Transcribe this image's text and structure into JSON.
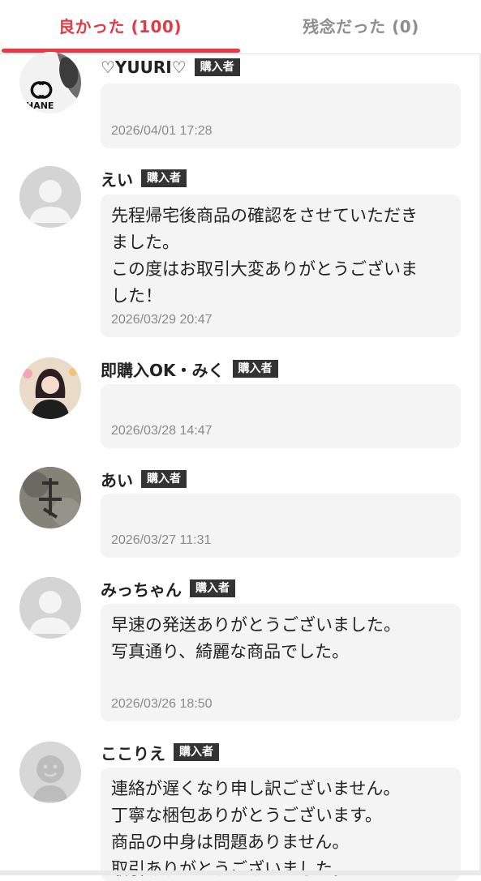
{
  "tabs": [
    {
      "label": "良かった (100)",
      "active": true
    },
    {
      "label": "残念だった (0)",
      "active": false
    }
  ],
  "colors": {
    "accent": "#e23b44",
    "inactive_tab": "#8e8e8e",
    "bubble_bg": "#f4f4f4",
    "badge_bg": "#333333"
  },
  "reviews": [
    {
      "name": "♡YUURI♡",
      "badge": "購入者",
      "comment": "",
      "date": "2026/04/01 17:28",
      "avatar": "chanel-photo"
    },
    {
      "name": "えい",
      "badge": "購入者",
      "comment": "先程帰宅後商品の確認をさせていただき\nました。\nこの度はお取引大変ありがとうございま\nした！",
      "date": "2026/03/29 20:47",
      "avatar": "default-person-icon"
    },
    {
      "name": "即購入OK・みく",
      "badge": "購入者",
      "comment": "",
      "date": "2026/03/28 14:47",
      "avatar": "anime-girl-photo"
    },
    {
      "name": "あい",
      "badge": "購入者",
      "comment": "",
      "date": "2026/03/27 11:31",
      "avatar": "stone-photo"
    },
    {
      "name": "みっちゃん",
      "badge": "購入者",
      "comment": "早速の発送ありがとうございました。\n写真通り、綺麗な商品でした。",
      "date": "2026/03/26 18:50",
      "avatar": "default-person-icon"
    },
    {
      "name": "ここりえ",
      "badge": "購入者",
      "comment": "連絡が遅くなり申し訳ございません。\n丁寧な梱包ありがとうございます。\n商品の中身は問題ありません。\n取引ありがとうございました。",
      "date": "",
      "avatar": "smiley-person-icon"
    }
  ]
}
